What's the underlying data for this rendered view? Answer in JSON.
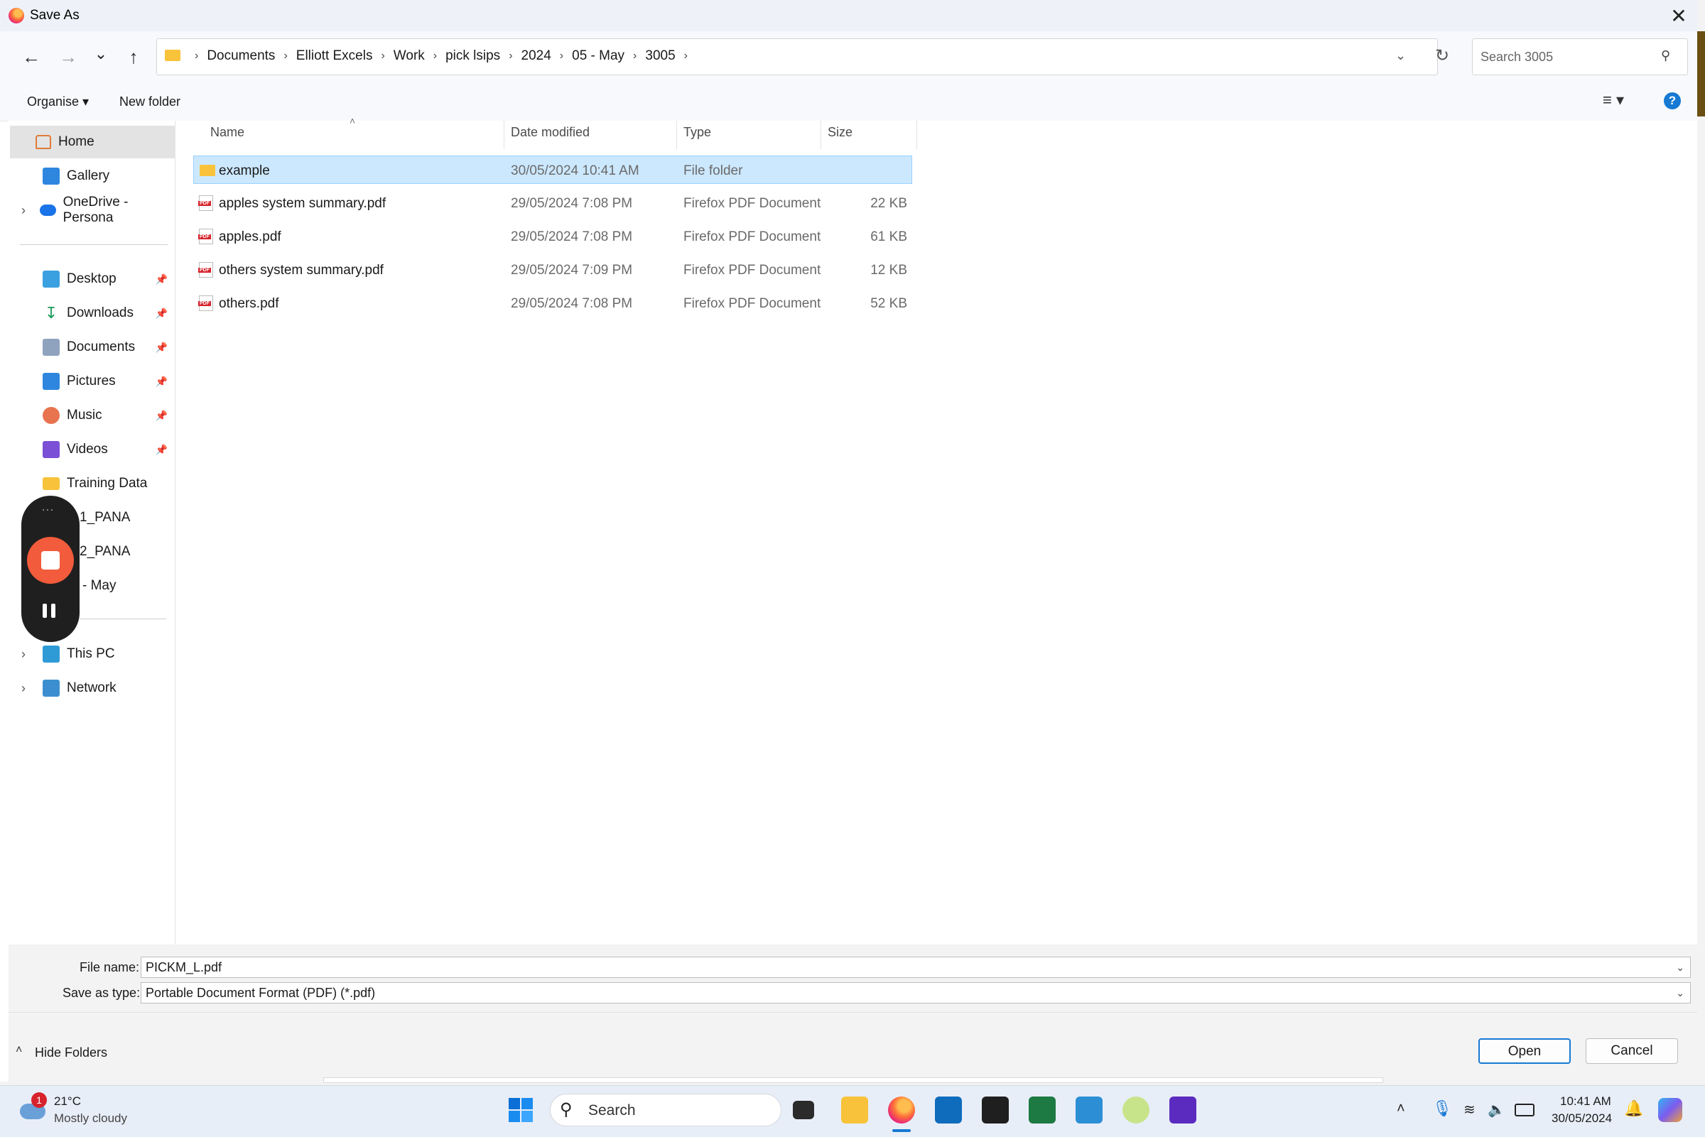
{
  "window": {
    "title": "Save As",
    "close_label": "✕"
  },
  "nav": {
    "back": "←",
    "forward": "→",
    "recent": "⌄",
    "up": "↑",
    "breadcrumbs": [
      "Documents",
      "Elliott Excels",
      "Work",
      "pick lsips",
      "2024",
      "05 - May",
      "3005"
    ],
    "separator": "›",
    "search_placeholder": "Search 3005"
  },
  "toolbar": {
    "organise": "Organise ▾",
    "new_folder": "New folder",
    "help": "?"
  },
  "sidebar": {
    "quick": [
      {
        "label": "Home"
      },
      {
        "label": "Gallery"
      },
      {
        "label": "OneDrive - Persona"
      }
    ],
    "pinned": [
      {
        "label": "Desktop"
      },
      {
        "label": "Downloads"
      },
      {
        "label": "Documents"
      },
      {
        "label": "Pictures"
      },
      {
        "label": "Music"
      },
      {
        "label": "Videos"
      },
      {
        "label": "Training Data"
      },
      {
        "label": "1_PANA"
      },
      {
        "label": "2_PANA"
      },
      {
        "label": "- May"
      }
    ],
    "bottom": [
      {
        "label": "This PC"
      },
      {
        "label": "Network"
      }
    ]
  },
  "columns": {
    "name": "Name",
    "date": "Date modified",
    "type": "Type",
    "size": "Size"
  },
  "files": [
    {
      "name": "example",
      "date": "30/05/2024 10:41 AM",
      "type": "File folder",
      "size": ""
    },
    {
      "name": "apples system summary.pdf",
      "date": "29/05/2024 7:08 PM",
      "type": "Firefox PDF Document",
      "size": "22 KB"
    },
    {
      "name": "apples.pdf",
      "date": "29/05/2024 7:08 PM",
      "type": "Firefox PDF Document",
      "size": "61 KB"
    },
    {
      "name": "others system summary.pdf",
      "date": "29/05/2024 7:09 PM",
      "type": "Firefox PDF Document",
      "size": "12 KB"
    },
    {
      "name": "others.pdf",
      "date": "29/05/2024 7:08 PM",
      "type": "Firefox PDF Document",
      "size": "52 KB"
    }
  ],
  "form": {
    "file_name_label": "File name:",
    "file_name_value": "PICKM_L.pdf",
    "save_type_label": "Save as type:",
    "save_type_value": "Portable Document Format (PDF) (*.pdf)"
  },
  "footer": {
    "hide_folders": "Hide Folders",
    "open": "Open",
    "cancel": "Cancel"
  },
  "taskbar": {
    "weather_temp": "21°C",
    "weather_desc": "Mostly cloudy",
    "weather_badge": "1",
    "search": "Search",
    "time": "10:41 AM",
    "date": "30/05/2024"
  },
  "colors": {
    "accent": "#1679d3",
    "selection": "#cce8ff",
    "record": "#f25b3b"
  }
}
